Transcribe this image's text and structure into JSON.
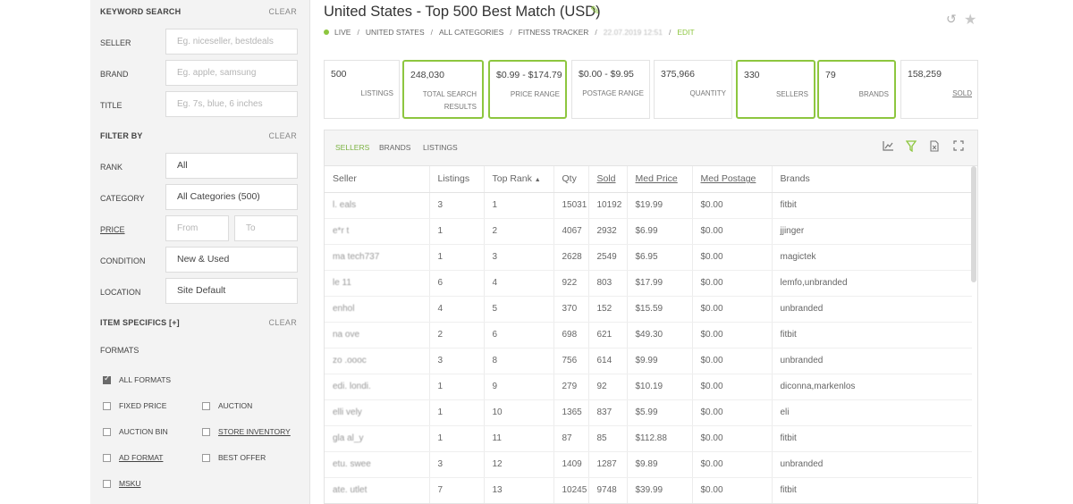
{
  "sidebar": {
    "keyword_search": {
      "title": "KEYWORD SEARCH",
      "clear": "CLEAR"
    },
    "seller": {
      "label": "SELLER",
      "placeholder": "Eg. niceseller, bestdeals"
    },
    "brand": {
      "label": "BRAND",
      "placeholder": "Eg. apple, samsung"
    },
    "title": {
      "label": "TITLE",
      "placeholder": "Eg. 7s, blue, 6 inches"
    },
    "filter_by": {
      "title": "FILTER BY",
      "clear": "CLEAR"
    },
    "rank": {
      "label": "RANK",
      "value": "All"
    },
    "category": {
      "label": "CATEGORY",
      "value": "All Categories (500)"
    },
    "price": {
      "label": "PRICE",
      "from_placeholder": "From",
      "to_placeholder": "To"
    },
    "condition": {
      "label": "CONDITION",
      "value": "New & Used"
    },
    "location": {
      "label": "LOCATION",
      "value": "Site Default"
    },
    "item_specifics": {
      "title": "ITEM SPECIFICS [+]",
      "clear": "CLEAR"
    },
    "formats": {
      "title": "FORMATS",
      "all_formats": "ALL FORMATS",
      "fixed_price": "FIXED PRICE",
      "auction": "AUCTION",
      "auction_bin": "AUCTION BIN",
      "store_inventory": "STORE INVENTORY",
      "ad_format": "AD FORMAT",
      "best_offer": "BEST OFFER",
      "msku": "MSKU"
    }
  },
  "header": {
    "title": "United States - Top 500 Best Match (USD)",
    "breadcrumb": {
      "status": "LIVE",
      "country": "UNITED STATES",
      "category": "ALL CATEGORIES",
      "keyword": "FITNESS TRACKER",
      "timestamp": "22.07.2019 12:51",
      "edit": "EDIT"
    }
  },
  "stats": [
    {
      "value": "500",
      "label": "LISTINGS"
    },
    {
      "value": "248,030",
      "label": "TOTAL SEARCH RESULTS"
    },
    {
      "value": "$0.99 - $174.79",
      "label": "PRICE RANGE"
    },
    {
      "value": "$0.00 - $9.95",
      "label": "POSTAGE RANGE"
    },
    {
      "value": "375,966",
      "label": "QUANTITY"
    },
    {
      "value": "330",
      "label": "SELLERS"
    },
    {
      "value": "79",
      "label": "BRANDS"
    },
    {
      "value": "158,259",
      "label": "SOLD"
    }
  ],
  "tabs": {
    "sellers": "SELLERS",
    "brands": "BRANDS",
    "listings": "LISTINGS"
  },
  "table": {
    "columns": {
      "seller": "Seller",
      "listings": "Listings",
      "top_rank": "Top Rank",
      "qty": "Qty",
      "sold": "Sold",
      "med_price": "Med Price",
      "med_postage": "Med Postage",
      "brands": "Brands"
    },
    "rows": [
      [
        "l.    eals",
        "3",
        "1",
        "15031",
        "10192",
        "$19.99",
        "$0.00",
        "fitbit"
      ],
      [
        "e*r    t",
        "1",
        "2",
        "4067",
        "2932",
        "$6.99",
        "$0.00",
        "jjinger"
      ],
      [
        "ma   tech737",
        "1",
        "3",
        "2628",
        "2549",
        "$6.95",
        "$0.00",
        "magictek"
      ],
      [
        "le    11",
        "6",
        "4",
        "922",
        "803",
        "$17.99",
        "$0.00",
        "lemfo,unbranded"
      ],
      [
        "     enhol",
        "4",
        "5",
        "370",
        "152",
        "$15.59",
        "$0.00",
        "unbranded"
      ],
      [
        "na     ove",
        "2",
        "6",
        "698",
        "621",
        "$49.30",
        "$0.00",
        "fitbit"
      ],
      [
        "zo   .oooc",
        "3",
        "8",
        "756",
        "614",
        "$9.99",
        "$0.00",
        "unbranded"
      ],
      [
        "edi.    londi.",
        "1",
        "9",
        "279",
        "92",
        "$10.19",
        "$0.00",
        "diconna,markenlos"
      ],
      [
        "elli    vely",
        "1",
        "10",
        "1365",
        "837",
        "$5.99",
        "$0.00",
        "eli"
      ],
      [
        "gla     al_y",
        "1",
        "11",
        "87",
        "85",
        "$112.88",
        "$0.00",
        "fitbit"
      ],
      [
        "etu.   swee",
        "3",
        "12",
        "1409",
        "1287",
        "$9.89",
        "$0.00",
        "unbranded"
      ],
      [
        "ate.   utlet",
        "7",
        "13",
        "10245",
        "9748",
        "$39.99",
        "$0.00",
        "fitbit"
      ]
    ]
  },
  "colors": {
    "accent": "#8dc63f",
    "sidebar_bg": "#f3f3f3"
  }
}
